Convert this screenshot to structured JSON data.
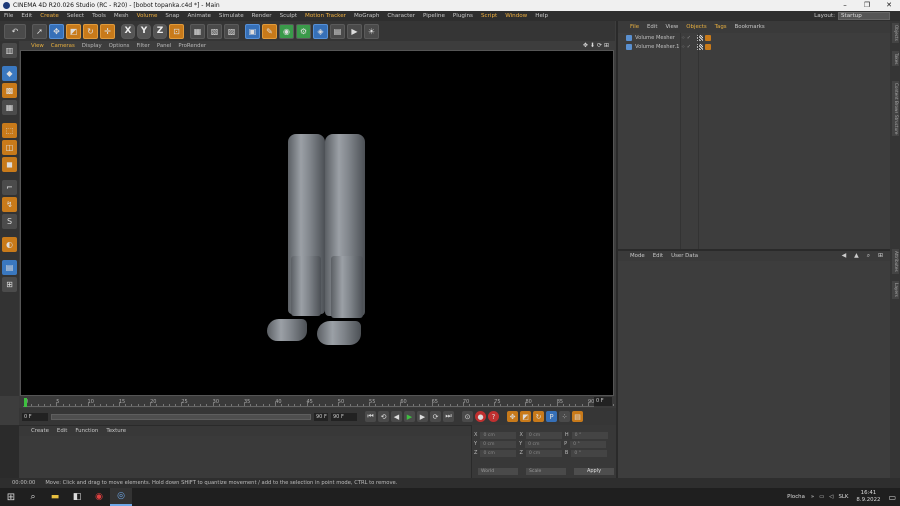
{
  "window": {
    "title": "CINEMA 4D R20.026 Studio (RC - R20) - [bobot topanka.c4d *] - Main",
    "minimize": "–",
    "maximize": "❐",
    "close": "✕"
  },
  "menubar": {
    "items": [
      "File",
      "Edit",
      "Create",
      "Select",
      "Tools",
      "Mesh",
      "Volume",
      "Snap",
      "Animate",
      "Simulate",
      "Render",
      "Sculpt",
      "Motion Tracker",
      "MoGraph",
      "Character",
      "Pipeline",
      "Plugins",
      "Script",
      "Window",
      "Help"
    ],
    "layout_label": "Layout:",
    "layout_value": "Startup"
  },
  "toolbar": {
    "undo_icon": "↶",
    "axis_x": "X",
    "axis_y": "Y",
    "axis_z": "Z"
  },
  "viewport": {
    "menu": [
      "View",
      "Cameras",
      "Display",
      "Options",
      "Filter",
      "Panel",
      "ProRender"
    ],
    "nav_icons": "✥⬇⟳⊞"
  },
  "timeline": {
    "ticks": [
      "0",
      "5",
      "10",
      "15",
      "20",
      "25",
      "30",
      "35",
      "40",
      "45",
      "50",
      "55",
      "60",
      "65",
      "70",
      "75",
      "80",
      "85",
      "90"
    ],
    "current_frame": "0 F"
  },
  "transport": {
    "start": "0 F",
    "mini": "0 F",
    "end": "90 F",
    "end2": "90 F"
  },
  "material": {
    "menu": [
      "Create",
      "Edit",
      "Function",
      "Texture"
    ]
  },
  "coordinates": {
    "rows": [
      {
        "a": "X",
        "av": "0 cm",
        "b": "X",
        "bv": "0 cm",
        "c": "H",
        "cv": "0 °"
      },
      {
        "a": "Y",
        "av": "0 cm",
        "b": "Y",
        "bv": "0 cm",
        "c": "P",
        "cv": "0 °"
      },
      {
        "a": "Z",
        "av": "0 cm",
        "b": "Z",
        "bv": "0 cm",
        "c": "B",
        "cv": "0 °"
      }
    ],
    "mode1": "World",
    "mode2": "Scale",
    "apply": "Apply"
  },
  "status": {
    "time": "00:00:00",
    "message": "Move: Click and drag to move elements. Hold down SHIFT to quantize movement / add to the selection in point mode, CTRL to remove."
  },
  "objects": {
    "menu": [
      "File",
      "Edit",
      "View",
      "Objects",
      "Tags",
      "Bookmarks"
    ],
    "items": [
      {
        "name": "Volume Mesher",
        "flags": "⁘ ✓"
      },
      {
        "name": "Volume Mesher.1",
        "flags": "⁘ ✓"
      }
    ]
  },
  "attributes": {
    "menu": [
      "Mode",
      "Edit",
      "User Data"
    ],
    "nav": "◀ ▲ ⌕ ⊞"
  },
  "right_tabs": [
    "Objects",
    "Takes",
    "Content Browser",
    "Structure",
    "Attributes",
    "Layers"
  ],
  "taskbar": {
    "lang": "SLK",
    "desktop": "Plocha",
    "time": "16:41",
    "date": "8.9.2022"
  }
}
